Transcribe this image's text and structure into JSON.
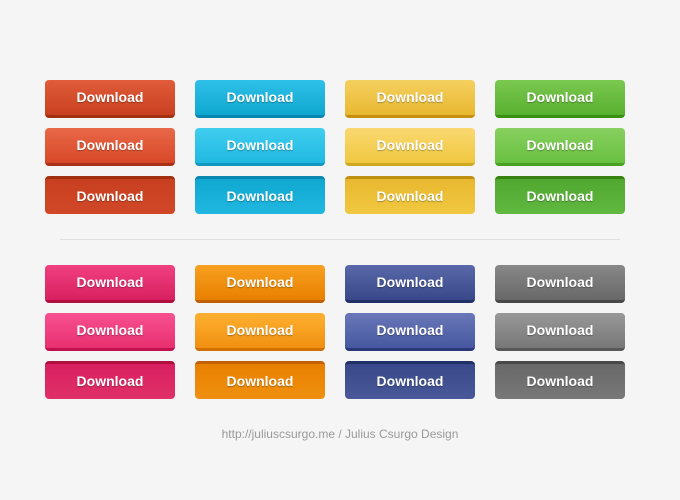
{
  "buttons": {
    "label": "Download"
  },
  "footer": {
    "text": "http://juliuscsurgo.me / Julius Csurgo Design"
  },
  "rows": [
    [
      {
        "id": "red-1",
        "label": "Download"
      },
      {
        "id": "cyan-1",
        "label": "Download"
      },
      {
        "id": "yellow-1",
        "label": "Download"
      },
      {
        "id": "green-1",
        "label": "Download"
      }
    ],
    [
      {
        "id": "red-2",
        "label": "Download"
      },
      {
        "id": "cyan-2",
        "label": "Download"
      },
      {
        "id": "yellow-2",
        "label": "Download"
      },
      {
        "id": "green-2",
        "label": "Download"
      }
    ],
    [
      {
        "id": "red-3",
        "label": "Download"
      },
      {
        "id": "cyan-3",
        "label": "Download"
      },
      {
        "id": "yellow-3",
        "label": "Download"
      },
      {
        "id": "green-3",
        "label": "Download"
      }
    ],
    [
      {
        "id": "pink-1",
        "label": "Download"
      },
      {
        "id": "orange-1",
        "label": "Download"
      },
      {
        "id": "navy-1",
        "label": "Download"
      },
      {
        "id": "gray-1",
        "label": "Download"
      }
    ],
    [
      {
        "id": "pink-2",
        "label": "Download"
      },
      {
        "id": "orange-2",
        "label": "Download"
      },
      {
        "id": "navy-2",
        "label": "Download"
      },
      {
        "id": "gray-2",
        "label": "Download"
      }
    ],
    [
      {
        "id": "pink-3",
        "label": "Download"
      },
      {
        "id": "orange-3",
        "label": "Download"
      },
      {
        "id": "navy-3",
        "label": "Download"
      },
      {
        "id": "gray-3",
        "label": "Download"
      }
    ]
  ]
}
